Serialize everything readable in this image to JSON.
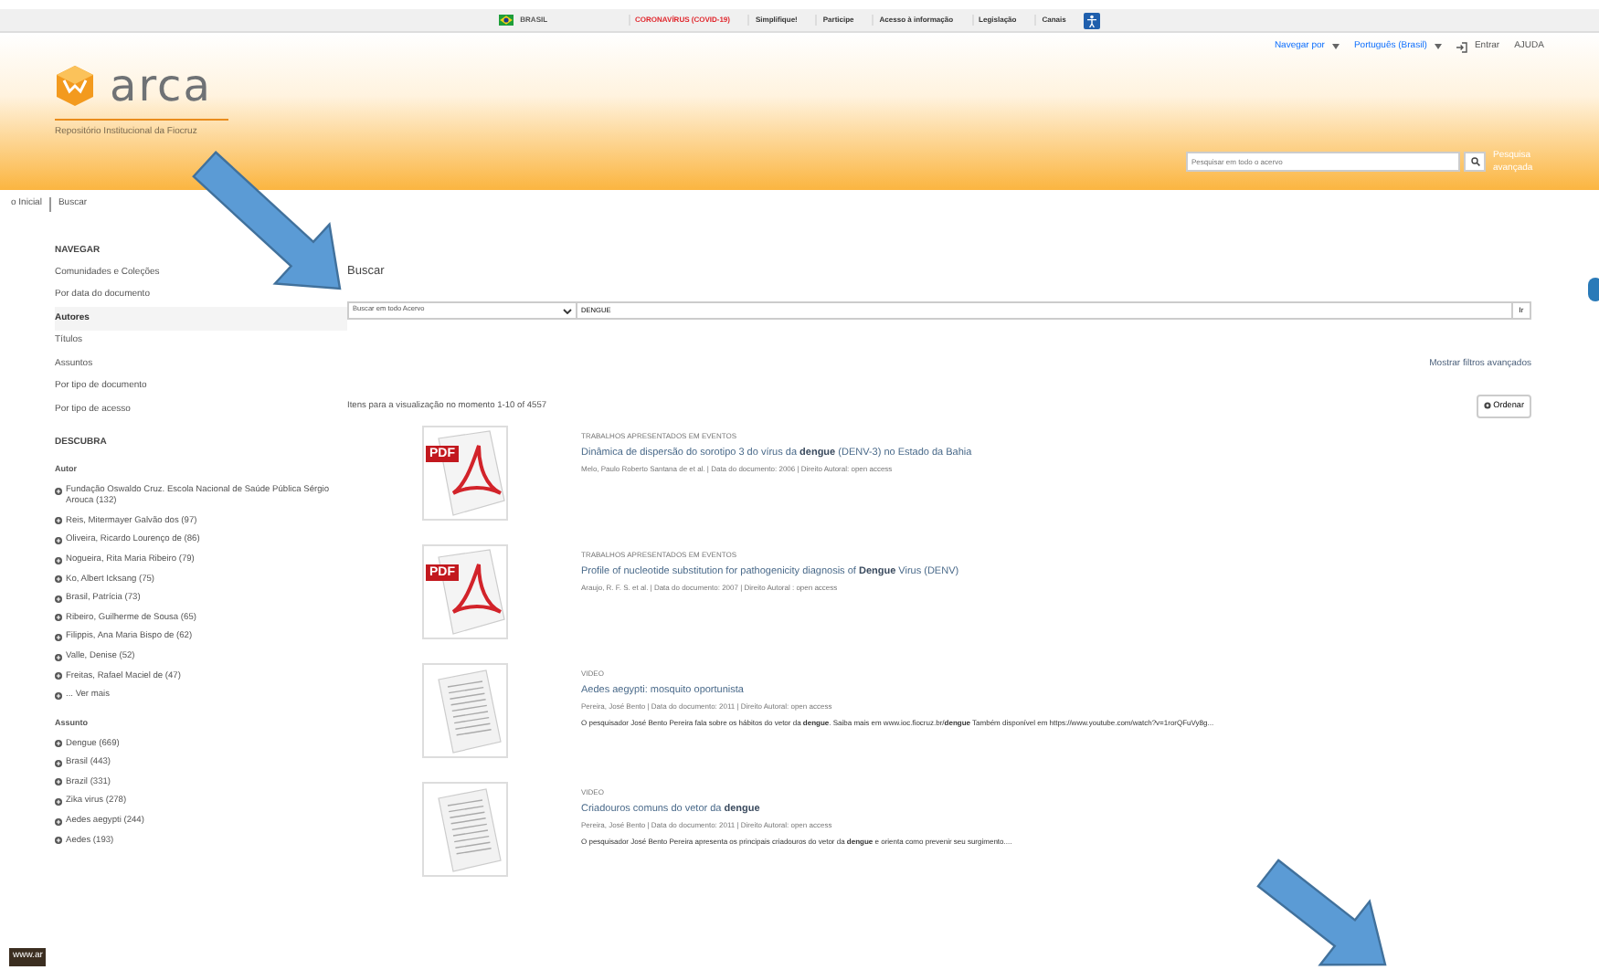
{
  "gov_bar": {
    "country": "BRASIL",
    "links": [
      {
        "text": "CORONAVÍRUS (COVID-19)",
        "kind": "alert"
      },
      {
        "text": "Simplifique!",
        "kind": "plain"
      },
      {
        "text": "Participe",
        "kind": "plain"
      },
      {
        "text": "Acesso à informação",
        "kind": "plain"
      },
      {
        "text": "Legislação",
        "kind": "plain"
      },
      {
        "text": "Canais",
        "kind": "plain"
      }
    ]
  },
  "header": {
    "menus": [
      "Navegar por",
      "Português (Brasil)"
    ],
    "login": "Entrar",
    "help": "AJUDA",
    "logo_text": "arca",
    "subtitle": "Repositório Institucional da Fiocruz",
    "search": {
      "placeholder": "Pesquisar em todo o acervo"
    },
    "advanced_link": "Pesquisa avançada"
  },
  "breadcrumb": [
    "o Inicial",
    "Buscar"
  ],
  "sidebar": {
    "heading": "NAVEGAR",
    "items": [
      {
        "label": "Comunidades e Coleções",
        "selected": false
      },
      {
        "label": "Por data do documento",
        "selected": false
      },
      {
        "label": "Autores",
        "selected": true
      },
      {
        "label": "Títulos",
        "selected": false
      },
      {
        "label": "Assuntos",
        "selected": false
      },
      {
        "label": "Por tipo de documento",
        "selected": false
      },
      {
        "label": "Por tipo de acesso",
        "selected": false
      }
    ],
    "discover_heading": "DESCUBRA",
    "facets": [
      {
        "title": "Autor",
        "items": [
          "Fundação Oswaldo Cruz. Escola Nacional de Saúde Pública Sérgio Arouca (132)",
          "Reis, Mitermayer Galvão dos (97)",
          "Oliveira, Ricardo Lourenço de (86)",
          "Nogueira, Rita Maria Ribeiro (79)",
          "Ko, Albert Icksang (75)",
          "Brasil, Patrícia (73)",
          "Ribeiro, Guilherme de Sousa (65)",
          "Filippis, Ana Maria Bispo de (62)",
          "Valle, Denise (52)",
          "Freitas, Rafael Maciel de (47)",
          "... Ver mais"
        ]
      },
      {
        "title": "Assunto",
        "items": [
          "Dengue (669)",
          "Brasil (443)",
          "Brazil (331)",
          "Zika virus (278)",
          "Aedes aegypti (244)",
          "Aedes (193)"
        ]
      }
    ]
  },
  "main": {
    "title": "Buscar",
    "scope_select": "Buscar em todo Acervo",
    "query": "DENGUE",
    "go_button": "Ir",
    "advanced_filters": "Mostrar filtros avançados",
    "results_info": "Itens para a visualização no momento 1-10 of 4557",
    "sort_button": "Ordenar",
    "results": [
      {
        "thumbnail": {
          "kind": "pdf",
          "label": "PDF"
        },
        "type": "TRABALHOS APRESENTADOS EM EVENTOS",
        "title": "Dinâmica de dispersão do sorotipo 3 do vírus da **dengue** (DENV-3) no Estado da Bahia",
        "meta": "Melo, Paulo Roberto Santana de et al.  | Data do documento: 2006 | Direito Autoral: open access"
      },
      {
        "thumbnail": {
          "kind": "pdf",
          "label": "PDF"
        },
        "type": "TRABALHOS APRESENTADOS EM EVENTOS",
        "title": "Profile of nucleotide substitution for pathogenicity diagnosis of **Dengue** Virus (DENV)",
        "meta": "Araujo, R. F. S. et al.  | Data do documento: 2007 | Direito Autoral : open access"
      },
      {
        "thumbnail": {
          "kind": "doc"
        },
        "type": "VIDEO",
        "title": "Aedes aegypti: mosquito oportunista",
        "meta": "Pereira, José Bento  | Data do documento: 2011 | Direito Autoral: open access",
        "abstract": "O pesquisador José Bento Pereira fala sobre os hábitos do vetor da **dengue**. Saiba mais em www.ioc.fiocruz.br/**dengue** Também disponível em https://www.youtube.com/watch?v=1rorQFuVy8g..."
      },
      {
        "thumbnail": {
          "kind": "doc"
        },
        "type": "VIDEO",
        "title": "Criadouros comuns do vetor da **dengue**",
        "meta": "Pereira, José Bento  | Data do documento: 2011 | Direito Autoral: open access",
        "abstract": "O pesquisador José Bento Pereira apresenta os principais criadouros do vetor da **dengue** e orienta como prevenir seu surgimento...."
      }
    ]
  },
  "footer": {
    "text": "www.ar"
  }
}
